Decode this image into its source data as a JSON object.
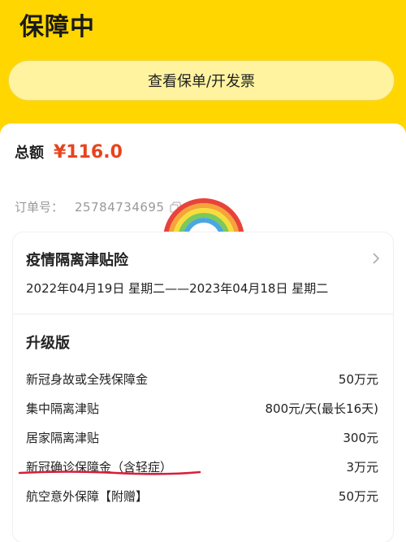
{
  "header": {
    "status": "保障中",
    "action_label": "查看保单/开发票"
  },
  "summary": {
    "total_label": "总额",
    "total_amount": "¥116.0",
    "order_label": "订单号：",
    "order_number": "25784734695"
  },
  "policy": {
    "name": "疫情隔离津贴险",
    "period": "2022年04月19日 星期二——2023年04月18日 星期二",
    "plan_name": "升级版",
    "coverages": [
      {
        "label": "新冠身故或全残保障金",
        "value": "50万元"
      },
      {
        "label": "集中隔离津贴",
        "value": "800元/天(最长16天)"
      },
      {
        "label": "居家隔离津贴",
        "value": "300元"
      },
      {
        "label": "新冠确诊保障金（含轻症）",
        "value": "3万元"
      },
      {
        "label": "航空意外保障【附赠】",
        "value": "50万元"
      }
    ]
  },
  "colors": {
    "header_bg": "#ffd600",
    "accent_red": "#e8431d",
    "underline_red": "#d81e3a"
  },
  "icons": {
    "copy": "copy-icon",
    "chevron": "chevron-right-icon",
    "sticker": "rainbow-sticker"
  }
}
